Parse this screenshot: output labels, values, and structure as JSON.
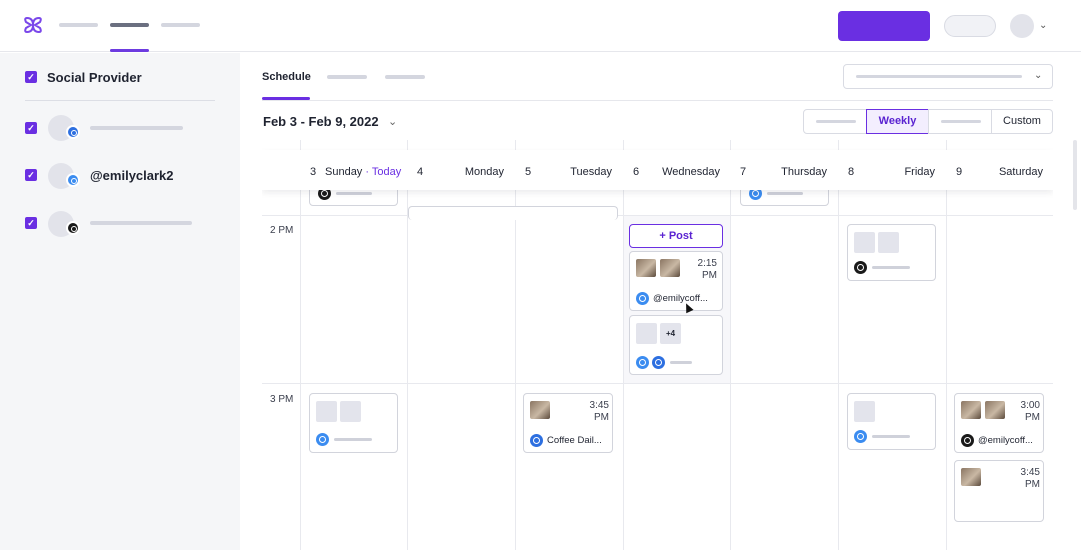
{
  "sidebar": {
    "title": "Social Provider",
    "accounts": [
      {
        "network": "facebook",
        "name": ""
      },
      {
        "network": "twitter",
        "name": "@emilyclark2"
      },
      {
        "network": "instagram",
        "name": ""
      }
    ]
  },
  "schedule": {
    "tab": "Schedule",
    "date_range": "Feb 3 - Feb 9, 2022",
    "views": {
      "weekly": "Weekly",
      "custom": "Custom"
    },
    "days": [
      {
        "num": "3",
        "name": "Sunday",
        "today": "Today"
      },
      {
        "num": "4",
        "name": "Monday"
      },
      {
        "num": "5",
        "name": "Tuesday"
      },
      {
        "num": "6",
        "name": "Wednesday"
      },
      {
        "num": "7",
        "name": "Thursday"
      },
      {
        "num": "8",
        "name": "Friday"
      },
      {
        "num": "9",
        "name": "Saturday"
      }
    ],
    "times": [
      "2 PM",
      "3 PM"
    ],
    "post_button": "Post",
    "today_separator": "·"
  },
  "posts": {
    "wed_215": {
      "time": "2:15\nPM",
      "handle": "@emilycoff..."
    },
    "wed_more": {
      "more": "+4"
    },
    "tue_345": {
      "time": "3:45\nPM",
      "text": "Coffee Dail..."
    },
    "sat_300": {
      "time": "3:00\nPM",
      "handle": "@emilycoff..."
    },
    "sat_345": {
      "time": "3:45\nPM"
    }
  },
  "colors": {
    "accent": "#6a2fe2",
    "twitter": "#3b8cf0",
    "facebook": "#2d6fe0",
    "instagram": "#1a1a1a"
  },
  "icons": {
    "logo": "brand-logo-icon",
    "chevron": "chevron-down-icon",
    "plus": "plus-icon",
    "cursor": "mouse-pointer-icon"
  }
}
